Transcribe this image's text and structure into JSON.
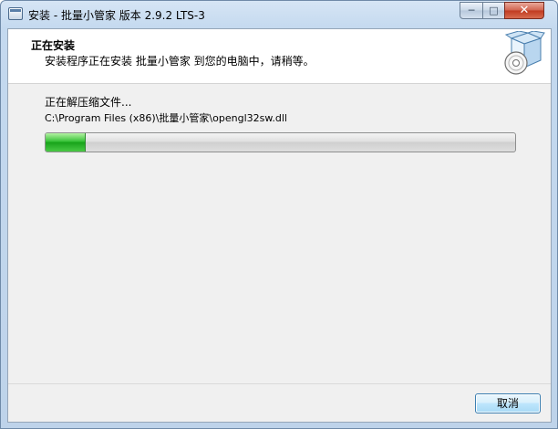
{
  "window": {
    "title": "安装 - 批量小管家 版本 2.9.2 LTS-3"
  },
  "header": {
    "title": "正在安装",
    "subtitle": "安装程序正在安装 批量小管家 到您的电脑中，请稍等。"
  },
  "content": {
    "status": "正在解压缩文件...",
    "current_file": "C:\\Program Files (x86)\\批量小管家\\opengl32sw.dll",
    "progress_fraction": 0.085
  },
  "buttons": {
    "cancel_label": "取消"
  },
  "title_buttons": {
    "minimize": "─",
    "maximize": "□",
    "close": "✕"
  },
  "colors": {
    "progress_green": "#17a31a",
    "close_red": "#c0391f"
  }
}
